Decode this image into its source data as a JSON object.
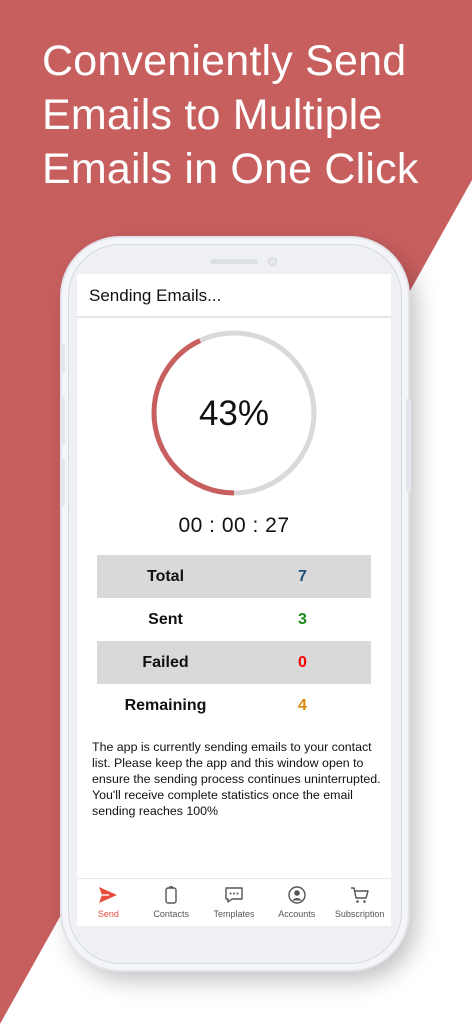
{
  "headline": [
    "Conveniently Send",
    "Emails to Multiple",
    "Emails in One Click"
  ],
  "colors": {
    "brand_red": "#c85f5f",
    "progress": "#c85f5f",
    "track": "#d9d9d9",
    "active_tab": "#e74c3c"
  },
  "screen": {
    "title": "Sending Emails...",
    "progress": {
      "value": 0.43,
      "label": "43%"
    },
    "timer": "00 : 00 : 27",
    "stats": [
      {
        "label": "Total",
        "value": "7",
        "color": "#1f4e79"
      },
      {
        "label": "Sent",
        "value": "3",
        "color": "#1a8a1a"
      },
      {
        "label": "Failed",
        "value": "0",
        "color": "#ff0000"
      },
      {
        "label": "Remaining",
        "value": "4",
        "color": "#d4890b"
      }
    ],
    "note": "The app is currently sending emails to your contact list. Please keep the app and this window open to ensure the sending process continues uninterrupted. You'll receive complete statistics once the email sending reaches 100%"
  },
  "tabs": [
    {
      "label": "Send",
      "icon": "send-icon",
      "active": true
    },
    {
      "label": "Contacts",
      "icon": "contacts-icon",
      "active": false
    },
    {
      "label": "Templates",
      "icon": "chat-icon",
      "active": false
    },
    {
      "label": "Accounts",
      "icon": "account-icon",
      "active": false
    },
    {
      "label": "Subscription",
      "icon": "cart-icon",
      "active": false
    }
  ]
}
